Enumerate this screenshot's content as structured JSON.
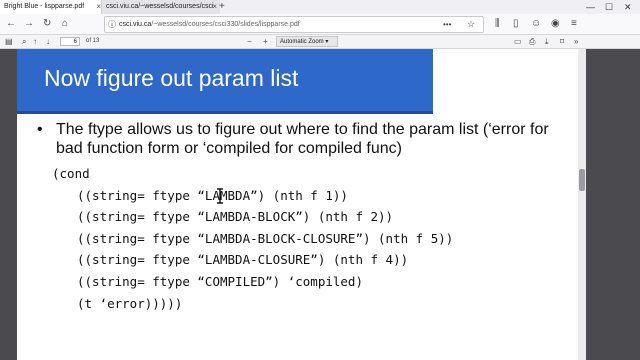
{
  "tabs": [
    {
      "label": "Bright Blue - lispparse.pdf",
      "active": true
    },
    {
      "label": "csci.viu.ca/~wesselsd/courses/csci",
      "active": false
    }
  ],
  "navbar": {
    "url_domain": "csci.viu.ca",
    "url_path": "/~wesselsd/courses/csci330/slides/lispparse.pdf",
    "more_label": "•••"
  },
  "pdf_toolbar": {
    "page_number": "6",
    "page_total": "of 13",
    "zoom_label": "Automatic Zoom",
    "zoom_out": "−",
    "zoom_in": "+"
  },
  "slide": {
    "title": "Now figure out param list",
    "bullet_symbol": "•",
    "bullet_text": "The ftype allows us to figure out where to find the param list (‘error for bad function form or ‘compiled for compiled func)",
    "code_lines": [
      "(cond",
      "((string= ftype “LAMBDA”) (nth f 1))",
      "((string= ftype “LAMBDA-BLOCK”) (nth f 2))",
      "((string= ftype “LAMBDA-BLOCK-CLOSURE”) (nth f 5))",
      "((string= ftype “LAMBDA-CLOSURE”) (nth f 4))",
      "((string= ftype “COMPILED”) ‘compiled)",
      "(t ‘error)))))"
    ]
  },
  "colors": {
    "banner": "#2e68c8",
    "viewer_bg": "#4a4a4f"
  }
}
